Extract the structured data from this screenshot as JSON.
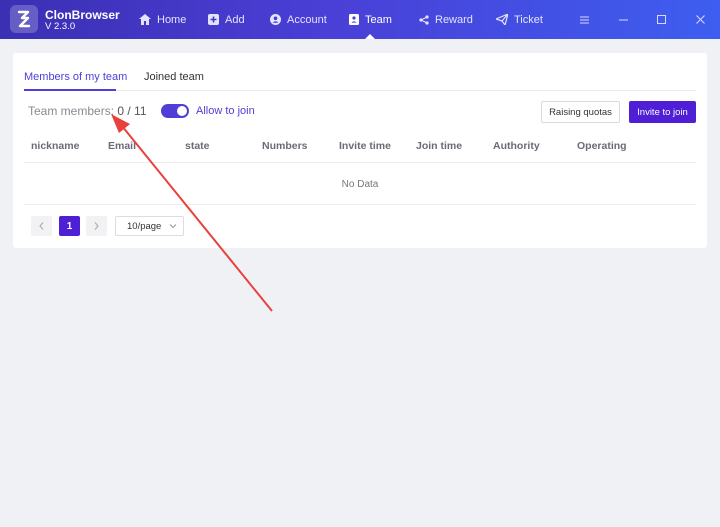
{
  "app": {
    "name": "ClonBrowser",
    "version": "V 2.3.0"
  },
  "nav": {
    "home": "Home",
    "add": "Add",
    "account": "Account",
    "team": "Team",
    "reward": "Reward",
    "ticket": "Ticket"
  },
  "tabs": {
    "members_of_my_team": "Members of my team",
    "joined_team": "Joined team"
  },
  "team": {
    "members_label": "Team members:",
    "members_count": "0 / 11",
    "allow_to_join": "Allow to join",
    "allow_to_join_enabled": true,
    "raising_quotas": "Raising quotas",
    "invite_to_join": "Invite to join"
  },
  "table": {
    "headers": [
      "nickname",
      "Email",
      "state",
      "Numbers",
      "Invite time",
      "Join time",
      "Authority",
      "Operating"
    ],
    "empty_text": "No Data"
  },
  "pagination": {
    "current_page": "1",
    "page_size": "10/page"
  },
  "colors": {
    "accent": "#4f3fd6",
    "annotation_arrow": "#e8413c"
  }
}
